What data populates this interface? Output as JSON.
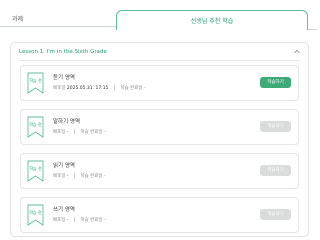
{
  "tabs": [
    {
      "label": "과제"
    },
    {
      "label": "선생님 추천 학습"
    }
  ],
  "lesson": {
    "title": "Lesson 1. I'm in the Sixth Grade"
  },
  "badge_label": "학습 전",
  "cards": [
    {
      "title": "듣기 영역",
      "meta_label": "배포일",
      "date": "2025.05.31. 17:15",
      "done_label": "학습 완료일",
      "done_value": "-",
      "button": "학습하기",
      "enabled": true
    },
    {
      "title": "말하기 영역",
      "meta_label": "배포일",
      "date": "-",
      "done_label": "학습 완료일",
      "done_value": "-",
      "button": "학습하기",
      "enabled": false
    },
    {
      "title": "읽기 영역",
      "meta_label": "배포일",
      "date": "-",
      "done_label": "학습 완료일",
      "done_value": "-",
      "button": "학습하기",
      "enabled": false
    },
    {
      "title": "쓰기 영역",
      "meta_label": "배포일",
      "date": "-",
      "done_label": "학습 완료일",
      "done_value": "-",
      "button": "학습하기",
      "enabled": false
    }
  ],
  "colors": {
    "accent": "#1f9c6e",
    "button_active": "#3daa78",
    "button_disabled": "#d9dcdb"
  }
}
